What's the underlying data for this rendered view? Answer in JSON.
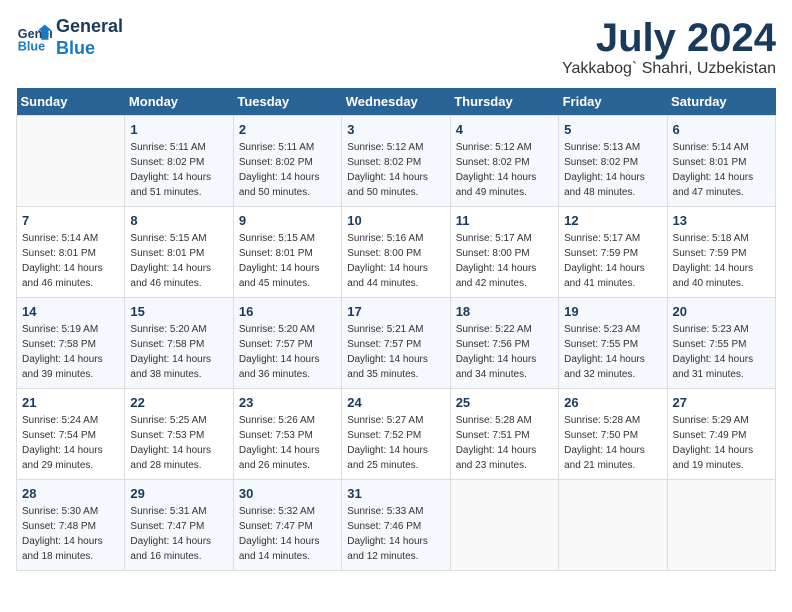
{
  "header": {
    "logo_line1": "General",
    "logo_line2": "Blue",
    "month": "July 2024",
    "location": "Yakkabog` Shahri, Uzbekistan"
  },
  "days_of_week": [
    "Sunday",
    "Monday",
    "Tuesday",
    "Wednesday",
    "Thursday",
    "Friday",
    "Saturday"
  ],
  "weeks": [
    [
      {
        "num": "",
        "sunrise": "",
        "sunset": "",
        "daylight": ""
      },
      {
        "num": "1",
        "sunrise": "Sunrise: 5:11 AM",
        "sunset": "Sunset: 8:02 PM",
        "daylight": "Daylight: 14 hours and 51 minutes."
      },
      {
        "num": "2",
        "sunrise": "Sunrise: 5:11 AM",
        "sunset": "Sunset: 8:02 PM",
        "daylight": "Daylight: 14 hours and 50 minutes."
      },
      {
        "num": "3",
        "sunrise": "Sunrise: 5:12 AM",
        "sunset": "Sunset: 8:02 PM",
        "daylight": "Daylight: 14 hours and 50 minutes."
      },
      {
        "num": "4",
        "sunrise": "Sunrise: 5:12 AM",
        "sunset": "Sunset: 8:02 PM",
        "daylight": "Daylight: 14 hours and 49 minutes."
      },
      {
        "num": "5",
        "sunrise": "Sunrise: 5:13 AM",
        "sunset": "Sunset: 8:02 PM",
        "daylight": "Daylight: 14 hours and 48 minutes."
      },
      {
        "num": "6",
        "sunrise": "Sunrise: 5:14 AM",
        "sunset": "Sunset: 8:01 PM",
        "daylight": "Daylight: 14 hours and 47 minutes."
      }
    ],
    [
      {
        "num": "7",
        "sunrise": "Sunrise: 5:14 AM",
        "sunset": "Sunset: 8:01 PM",
        "daylight": "Daylight: 14 hours and 46 minutes."
      },
      {
        "num": "8",
        "sunrise": "Sunrise: 5:15 AM",
        "sunset": "Sunset: 8:01 PM",
        "daylight": "Daylight: 14 hours and 46 minutes."
      },
      {
        "num": "9",
        "sunrise": "Sunrise: 5:15 AM",
        "sunset": "Sunset: 8:01 PM",
        "daylight": "Daylight: 14 hours and 45 minutes."
      },
      {
        "num": "10",
        "sunrise": "Sunrise: 5:16 AM",
        "sunset": "Sunset: 8:00 PM",
        "daylight": "Daylight: 14 hours and 44 minutes."
      },
      {
        "num": "11",
        "sunrise": "Sunrise: 5:17 AM",
        "sunset": "Sunset: 8:00 PM",
        "daylight": "Daylight: 14 hours and 42 minutes."
      },
      {
        "num": "12",
        "sunrise": "Sunrise: 5:17 AM",
        "sunset": "Sunset: 7:59 PM",
        "daylight": "Daylight: 14 hours and 41 minutes."
      },
      {
        "num": "13",
        "sunrise": "Sunrise: 5:18 AM",
        "sunset": "Sunset: 7:59 PM",
        "daylight": "Daylight: 14 hours and 40 minutes."
      }
    ],
    [
      {
        "num": "14",
        "sunrise": "Sunrise: 5:19 AM",
        "sunset": "Sunset: 7:58 PM",
        "daylight": "Daylight: 14 hours and 39 minutes."
      },
      {
        "num": "15",
        "sunrise": "Sunrise: 5:20 AM",
        "sunset": "Sunset: 7:58 PM",
        "daylight": "Daylight: 14 hours and 38 minutes."
      },
      {
        "num": "16",
        "sunrise": "Sunrise: 5:20 AM",
        "sunset": "Sunset: 7:57 PM",
        "daylight": "Daylight: 14 hours and 36 minutes."
      },
      {
        "num": "17",
        "sunrise": "Sunrise: 5:21 AM",
        "sunset": "Sunset: 7:57 PM",
        "daylight": "Daylight: 14 hours and 35 minutes."
      },
      {
        "num": "18",
        "sunrise": "Sunrise: 5:22 AM",
        "sunset": "Sunset: 7:56 PM",
        "daylight": "Daylight: 14 hours and 34 minutes."
      },
      {
        "num": "19",
        "sunrise": "Sunrise: 5:23 AM",
        "sunset": "Sunset: 7:55 PM",
        "daylight": "Daylight: 14 hours and 32 minutes."
      },
      {
        "num": "20",
        "sunrise": "Sunrise: 5:23 AM",
        "sunset": "Sunset: 7:55 PM",
        "daylight": "Daylight: 14 hours and 31 minutes."
      }
    ],
    [
      {
        "num": "21",
        "sunrise": "Sunrise: 5:24 AM",
        "sunset": "Sunset: 7:54 PM",
        "daylight": "Daylight: 14 hours and 29 minutes."
      },
      {
        "num": "22",
        "sunrise": "Sunrise: 5:25 AM",
        "sunset": "Sunset: 7:53 PM",
        "daylight": "Daylight: 14 hours and 28 minutes."
      },
      {
        "num": "23",
        "sunrise": "Sunrise: 5:26 AM",
        "sunset": "Sunset: 7:53 PM",
        "daylight": "Daylight: 14 hours and 26 minutes."
      },
      {
        "num": "24",
        "sunrise": "Sunrise: 5:27 AM",
        "sunset": "Sunset: 7:52 PM",
        "daylight": "Daylight: 14 hours and 25 minutes."
      },
      {
        "num": "25",
        "sunrise": "Sunrise: 5:28 AM",
        "sunset": "Sunset: 7:51 PM",
        "daylight": "Daylight: 14 hours and 23 minutes."
      },
      {
        "num": "26",
        "sunrise": "Sunrise: 5:28 AM",
        "sunset": "Sunset: 7:50 PM",
        "daylight": "Daylight: 14 hours and 21 minutes."
      },
      {
        "num": "27",
        "sunrise": "Sunrise: 5:29 AM",
        "sunset": "Sunset: 7:49 PM",
        "daylight": "Daylight: 14 hours and 19 minutes."
      }
    ],
    [
      {
        "num": "28",
        "sunrise": "Sunrise: 5:30 AM",
        "sunset": "Sunset: 7:48 PM",
        "daylight": "Daylight: 14 hours and 18 minutes."
      },
      {
        "num": "29",
        "sunrise": "Sunrise: 5:31 AM",
        "sunset": "Sunset: 7:47 PM",
        "daylight": "Daylight: 14 hours and 16 minutes."
      },
      {
        "num": "30",
        "sunrise": "Sunrise: 5:32 AM",
        "sunset": "Sunset: 7:47 PM",
        "daylight": "Daylight: 14 hours and 14 minutes."
      },
      {
        "num": "31",
        "sunrise": "Sunrise: 5:33 AM",
        "sunset": "Sunset: 7:46 PM",
        "daylight": "Daylight: 14 hours and 12 minutes."
      },
      {
        "num": "",
        "sunrise": "",
        "sunset": "",
        "daylight": ""
      },
      {
        "num": "",
        "sunrise": "",
        "sunset": "",
        "daylight": ""
      },
      {
        "num": "",
        "sunrise": "",
        "sunset": "",
        "daylight": ""
      }
    ]
  ]
}
